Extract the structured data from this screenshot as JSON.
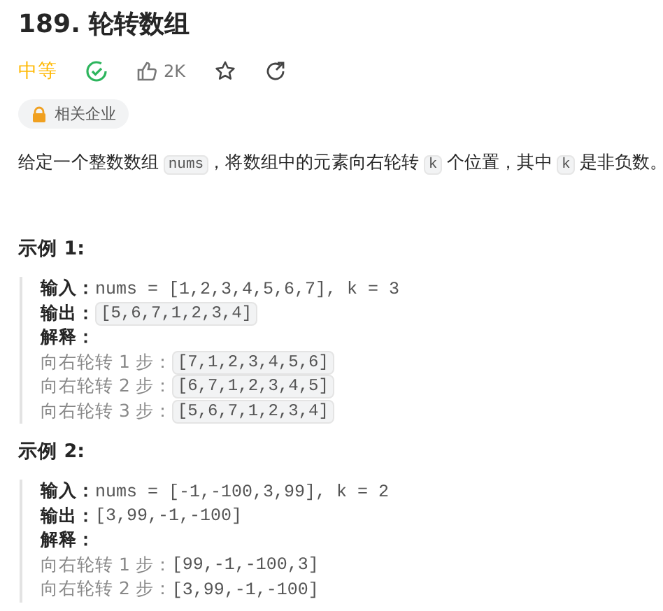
{
  "title": "189. 轮转数组",
  "meta": {
    "difficulty": "中等",
    "solved": true,
    "likes": "2K"
  },
  "tags": [
    {
      "label": "相关企业"
    }
  ],
  "description": [
    {
      "kind": "text",
      "text": "给定一个整数数组 "
    },
    {
      "kind": "code",
      "text": "nums"
    },
    {
      "kind": "text",
      "text": "，将数组中的元素向右轮转 "
    },
    {
      "kind": "code",
      "text": "k"
    },
    {
      "kind": "text",
      "text": " 个位置，其中 "
    },
    {
      "kind": "code",
      "text": "k"
    },
    {
      "kind": "text",
      "text": " 是非负数。"
    }
  ],
  "examples": [
    {
      "title": "示例 1:",
      "lines": [
        {
          "kind": "field",
          "label": "输入：",
          "value": "nums = [1,2,3,4,5,6,7], k = 3",
          "chip": false
        },
        {
          "kind": "field",
          "label": "输出：",
          "value": "[5,6,7,1,2,3,4]",
          "chip": true
        },
        {
          "kind": "field",
          "label": "解释："
        },
        {
          "kind": "step",
          "label": "向右轮转 1 步：",
          "value": "[7,1,2,3,4,5,6]",
          "chip": true
        },
        {
          "kind": "step",
          "label": "向右轮转 2 步：",
          "value": "[6,7,1,2,3,4,5]",
          "chip": true
        },
        {
          "kind": "step",
          "label": "向右轮转 3 步：",
          "value": "[5,6,7,1,2,3,4]",
          "chip": true
        }
      ]
    },
    {
      "title": "示例 2:",
      "lines": [
        {
          "kind": "field",
          "label": "输入：",
          "value": "nums = [-1,-100,3,99], k = 2",
          "chip": false
        },
        {
          "kind": "field",
          "label": "输出：",
          "value": "[3,99,-1,-100]",
          "chip": false
        },
        {
          "kind": "field",
          "label": "解释："
        },
        {
          "kind": "step",
          "label": "向右轮转 1 步：",
          "value": "[99,-1,-100,3]",
          "chip": false
        },
        {
          "kind": "step",
          "label": "向右轮转 2 步：",
          "value": "[3,99,-1,-100]",
          "chip": false
        }
      ]
    }
  ]
}
